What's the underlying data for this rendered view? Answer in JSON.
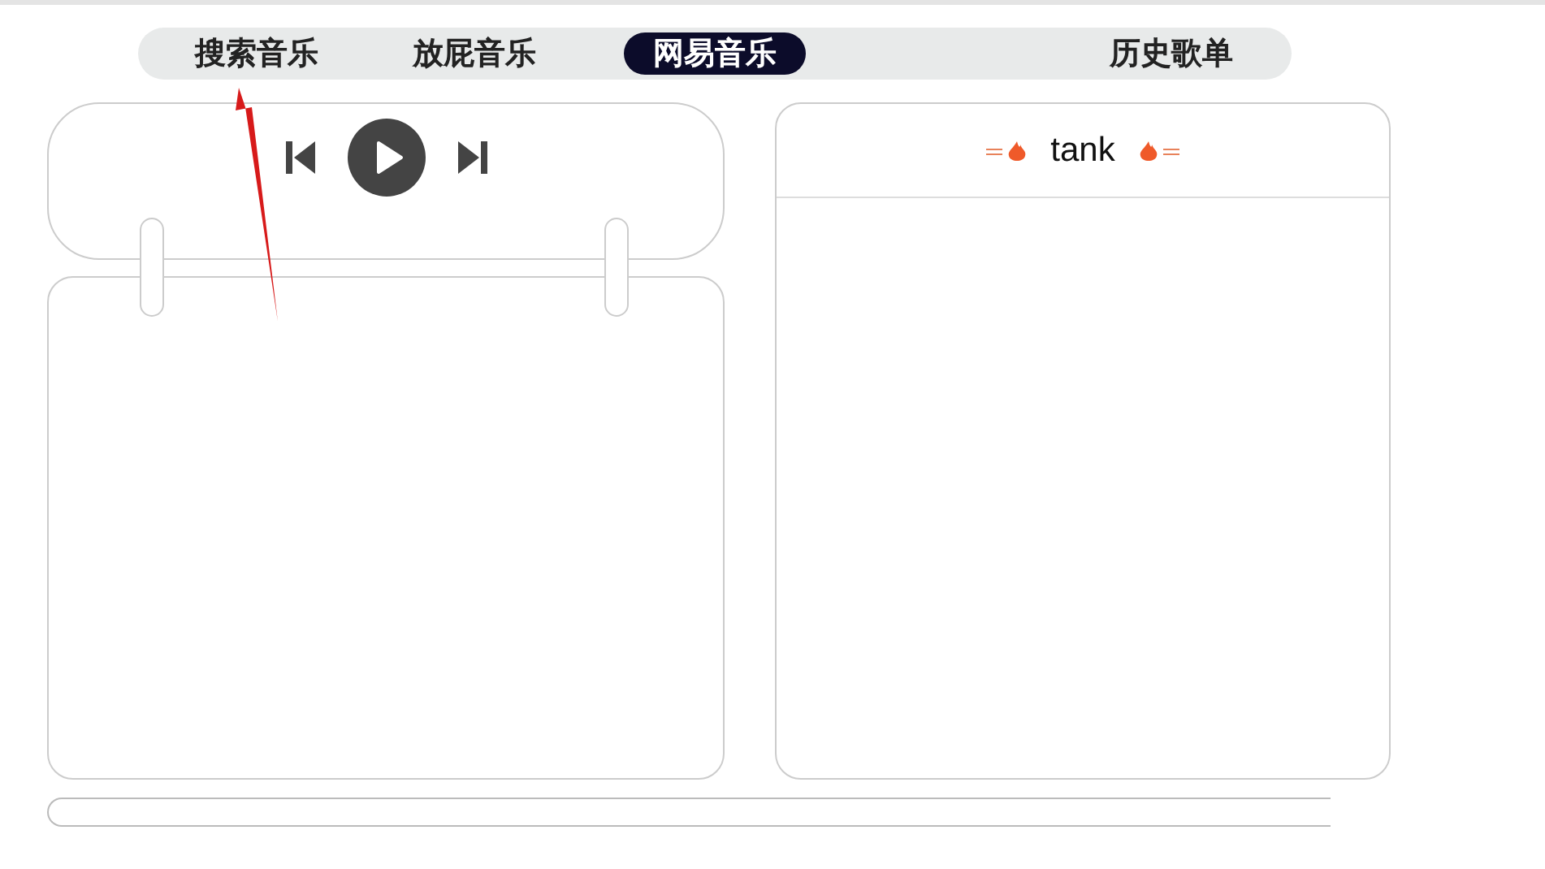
{
  "tabs": [
    {
      "label": "搜索音乐",
      "selected": false
    },
    {
      "label": "放屁音乐",
      "selected": false
    },
    {
      "label": "网易音乐",
      "selected": true
    },
    {
      "label": "历史歌单",
      "selected": false
    }
  ],
  "playlist": {
    "title": "tank"
  }
}
